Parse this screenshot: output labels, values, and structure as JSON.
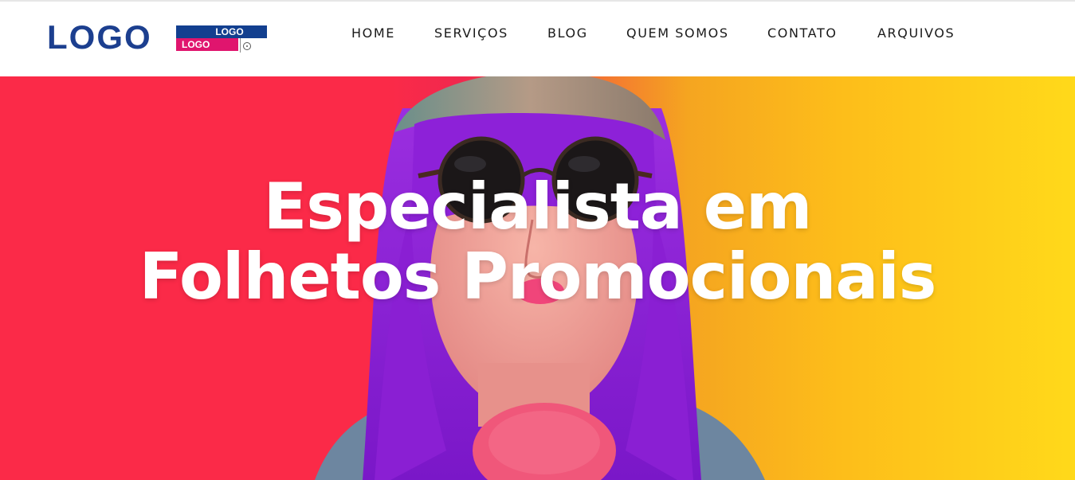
{
  "header": {
    "logo_text": "LOGO",
    "badge": {
      "top_label": "LOGO",
      "bottom_label": "LOGO"
    }
  },
  "nav": {
    "items": [
      {
        "label": "HOME"
      },
      {
        "label": "SERVIÇOS"
      },
      {
        "label": "BLOG"
      },
      {
        "label": "QUEM SOMOS"
      },
      {
        "label": "CONTATO"
      },
      {
        "label": "ARQUIVOS"
      }
    ]
  },
  "hero": {
    "title_line1": "Especialista em",
    "title_line2": "Folhetos Promocionais"
  },
  "colors": {
    "logo_blue": "#1c3f8f",
    "badge_blue": "#123f8f",
    "badge_pink": "#e0156e",
    "hero_red": "#fb2a48",
    "hero_yellow": "#ffd91a",
    "hair_purple": "#8e1ed0"
  }
}
